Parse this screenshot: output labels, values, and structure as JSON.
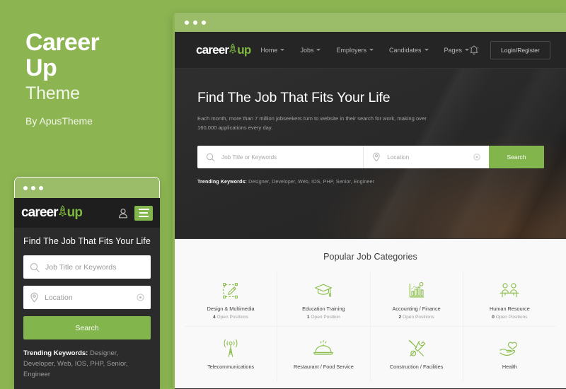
{
  "promo": {
    "title_line1": "Career",
    "title_line2": "Up",
    "subtitle": "Theme",
    "author": "By ApusTheme",
    "brand_green": "#8cb552"
  },
  "logo": {
    "text": "career",
    "accent": "up",
    "accent_color": "#7fb642"
  },
  "mobile": {
    "heading": "Find The Job That Fits Your Life",
    "search_placeholder": "Job Title or Keywords",
    "location_placeholder": "Location",
    "search_button": "Search",
    "trending_label": "Trending Keywords:",
    "trending_keywords": "Designer, Developer, Web, IOS, PHP, Senior, Engineer",
    "user_icon": "user-icon",
    "menu_icon": "hamburger-menu-icon"
  },
  "desktop": {
    "nav": [
      {
        "label": "Home"
      },
      {
        "label": "Jobs"
      },
      {
        "label": "Employers"
      },
      {
        "label": "Candidates"
      },
      {
        "label": "Pages"
      }
    ],
    "bell_icon": "notification-bell-icon",
    "login_button": "Login/Register",
    "hero": {
      "heading": "Find The Job That Fits Your Life",
      "paragraph": "Each month, more than 7 million jobseekers turn to website in their search for work, making over 160,000 applications every day.",
      "search_placeholder": "Job Title or Keywords",
      "location_placeholder": "Location",
      "search_button": "Search",
      "trending_label": "Trending Keywords:",
      "trending_keywords": "Designer, Developer, Web, IOS, PHP, Senior, Engineer"
    },
    "categories_title": "Popular Job Categories",
    "categories": [
      {
        "name": "Design & Multimedia",
        "count": "4",
        "count_label": "Open Positions",
        "icon": "design-multimedia-icon"
      },
      {
        "name": "Education Training",
        "count": "1",
        "count_label": "Open Position",
        "icon": "graduation-cap-icon"
      },
      {
        "name": "Accounting / Finance",
        "count": "2",
        "count_label": "Open Positions",
        "icon": "bar-chart-icon"
      },
      {
        "name": "Human Resource",
        "count": "0",
        "count_label": "Open Positions",
        "icon": "people-desk-icon"
      },
      {
        "name": "Telecommunications",
        "count": "",
        "count_label": "",
        "icon": "antenna-tower-icon"
      },
      {
        "name": "Restaurant / Food Service",
        "count": "",
        "count_label": "",
        "icon": "food-cloche-icon"
      },
      {
        "name": "Construction / Facilities",
        "count": "",
        "count_label": "",
        "icon": "tools-wrench-icon"
      },
      {
        "name": "Health",
        "count": "",
        "count_label": "",
        "icon": "hand-heart-icon"
      }
    ]
  }
}
